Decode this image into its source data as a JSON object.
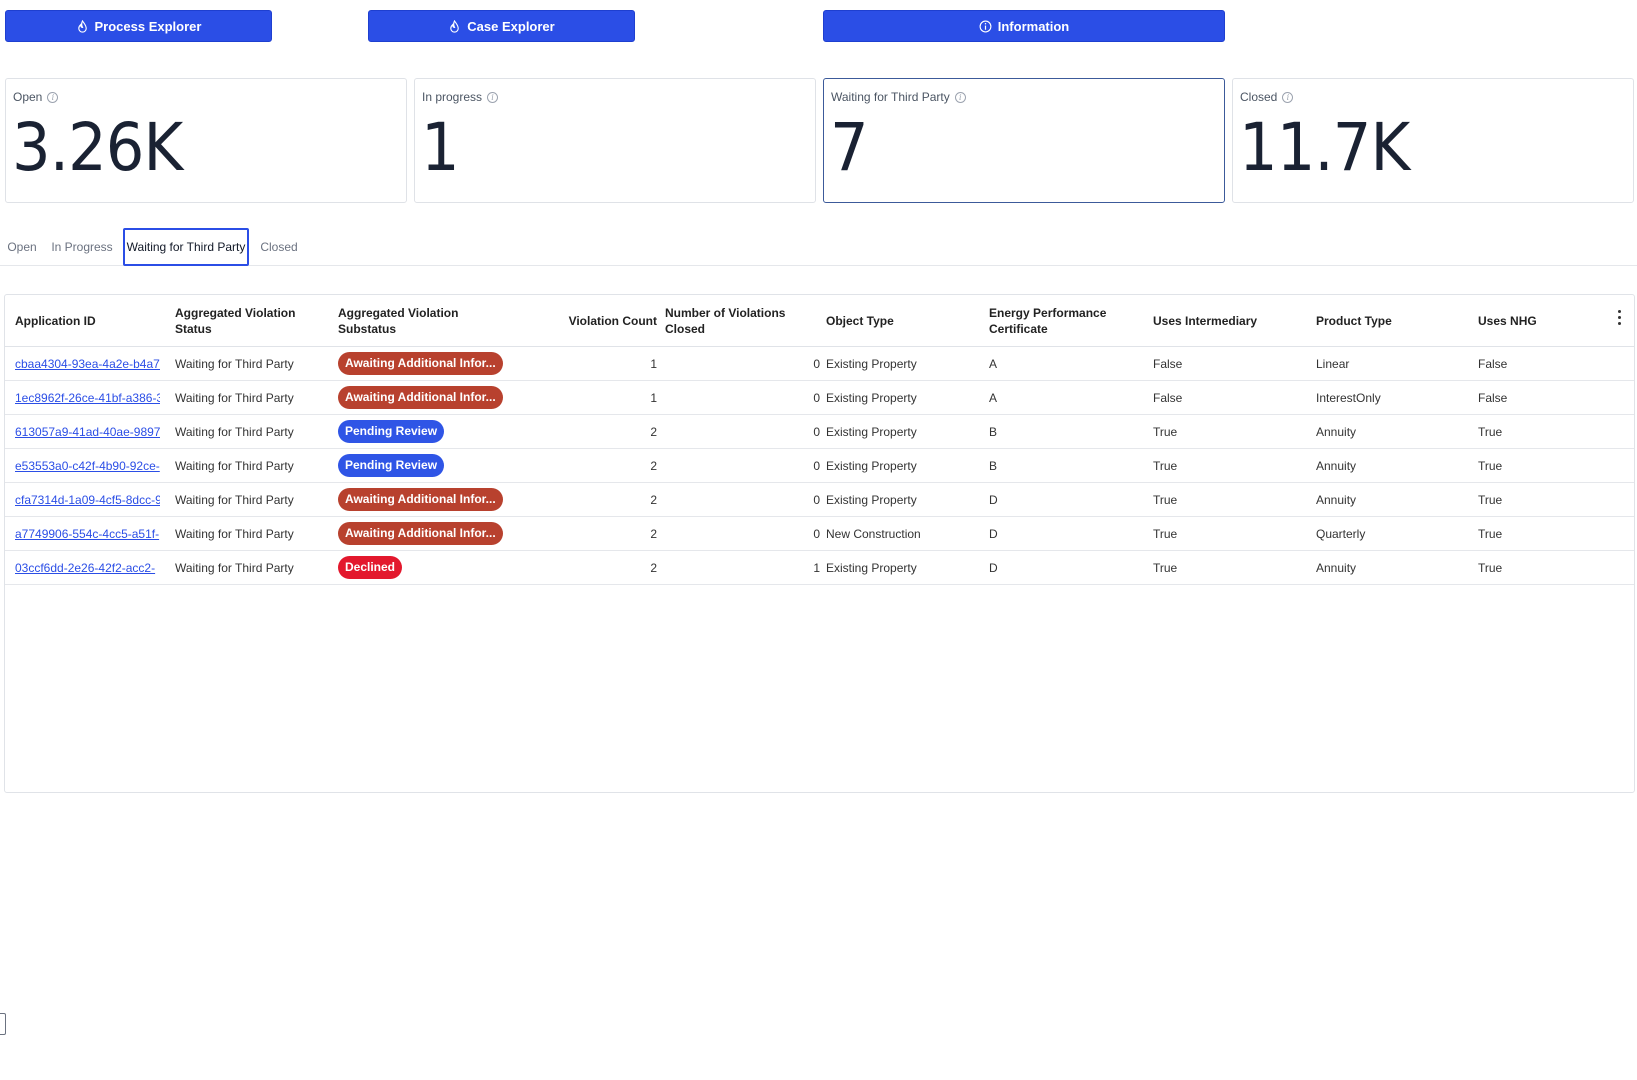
{
  "nav": {
    "process_explorer": "Process Explorer",
    "case_explorer": "Case Explorer",
    "information": "Information"
  },
  "kpis": {
    "open": {
      "label": "Open",
      "value": "3.26K"
    },
    "in_progress": {
      "label": "In progress",
      "value": "1"
    },
    "waiting": {
      "label": "Waiting for Third Party",
      "value": "7"
    },
    "closed": {
      "label": "Closed",
      "value": "11.7K"
    }
  },
  "tabs": {
    "open": "Open",
    "in_progress": "In Progress",
    "waiting": "Waiting for Third Party",
    "closed": "Closed"
  },
  "table": {
    "headers": {
      "application_id": "Application ID",
      "agg_status": "Aggregated Violation Status",
      "agg_substatus": "Aggregated Violation Substatus",
      "violation_count": "Violation Count",
      "violations_closed": "Number of Violations Closed",
      "object_type": "Object Type",
      "epc": "Energy Performance Certificate",
      "uses_intermediary": "Uses Intermediary",
      "product_type": "Product Type",
      "uses_nhg": "Uses NHG"
    },
    "rows": [
      {
        "id": "cbaa4304-93ea-4a2e-b4a7-",
        "status": "Waiting for Third Party",
        "substatus": "Awaiting Additional Infor...",
        "pill": "awaiting",
        "count": "1",
        "closed": "0",
        "object": "Existing Property",
        "epc": "A",
        "intermediary": "False",
        "product": "Linear",
        "nhg": "False"
      },
      {
        "id": "1ec8962f-26ce-41bf-a386-3",
        "status": "Waiting for Third Party",
        "substatus": "Awaiting Additional Infor...",
        "pill": "awaiting",
        "count": "1",
        "closed": "0",
        "object": "Existing Property",
        "epc": "A",
        "intermediary": "False",
        "product": "InterestOnly",
        "nhg": "False"
      },
      {
        "id": "613057a9-41ad-40ae-9897-",
        "status": "Waiting for Third Party",
        "substatus": "Pending Review",
        "pill": "pending",
        "count": "2",
        "closed": "0",
        "object": "Existing Property",
        "epc": "B",
        "intermediary": "True",
        "product": "Annuity",
        "nhg": "True"
      },
      {
        "id": "e53553a0-c42f-4b90-92ce-",
        "status": "Waiting for Third Party",
        "substatus": "Pending Review",
        "pill": "pending",
        "count": "2",
        "closed": "0",
        "object": "Existing Property",
        "epc": "B",
        "intermediary": "True",
        "product": "Annuity",
        "nhg": "True"
      },
      {
        "id": "cfa7314d-1a09-4cf5-8dcc-9",
        "status": "Waiting for Third Party",
        "substatus": "Awaiting Additional Infor...",
        "pill": "awaiting",
        "count": "2",
        "closed": "0",
        "object": "Existing Property",
        "epc": "D",
        "intermediary": "True",
        "product": "Annuity",
        "nhg": "True"
      },
      {
        "id": "a7749906-554c-4cc5-a51f-",
        "status": "Waiting for Third Party",
        "substatus": "Awaiting Additional Infor...",
        "pill": "awaiting",
        "count": "2",
        "closed": "0",
        "object": "New Construction",
        "epc": "D",
        "intermediary": "True",
        "product": "Quarterly",
        "nhg": "True"
      },
      {
        "id": "03ccf6dd-2e26-42f2-acc2-",
        "status": "Waiting for Third Party",
        "substatus": "Declined",
        "pill": "declined",
        "count": "2",
        "closed": "1",
        "object": "Existing Property",
        "epc": "D",
        "intermediary": "True",
        "product": "Annuity",
        "nhg": "True"
      }
    ]
  },
  "colors": {
    "primary": "#2b4ee6",
    "awaiting": "#b8412e",
    "pending": "#2f55e6",
    "declined": "#e3182d"
  }
}
